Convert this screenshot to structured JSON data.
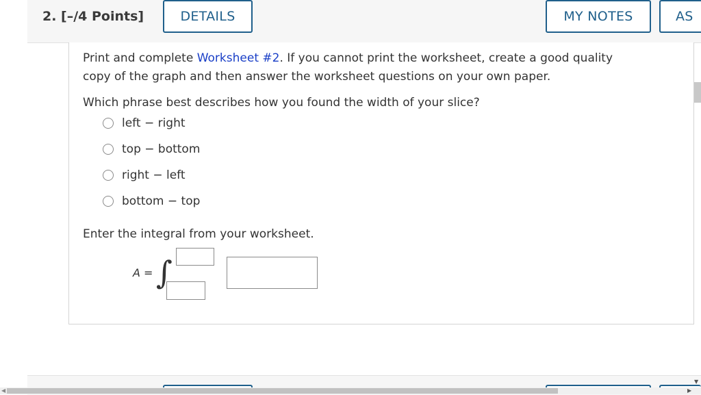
{
  "header": {
    "question_label": "2.  [–/4 Points]",
    "details_label": "DETAILS",
    "notes_label": "MY NOTES",
    "ask_label": "AS"
  },
  "prompt": {
    "before_link": "Print and complete ",
    "link_text": "Worksheet #2",
    "after_link": ". If you cannot print the worksheet, create a good quality copy of the graph and then answer the worksheet questions on your own paper."
  },
  "question": {
    "text": "Which phrase best describes how you found the width of your slice?",
    "options": [
      "left − right",
      "top − bottom",
      "right − left",
      "bottom − top"
    ]
  },
  "integral": {
    "label": "Enter the integral from your worksheet.",
    "var": "A",
    "equals": "=",
    "sign": "∫",
    "upper_value": "",
    "lower_value": "",
    "integrand_value": ""
  },
  "icons": {
    "scroll_left": "scroll-left-arrow-icon",
    "scroll_right": "scroll-right-arrow-icon",
    "scroll_down": "scroll-down-arrow-icon"
  }
}
